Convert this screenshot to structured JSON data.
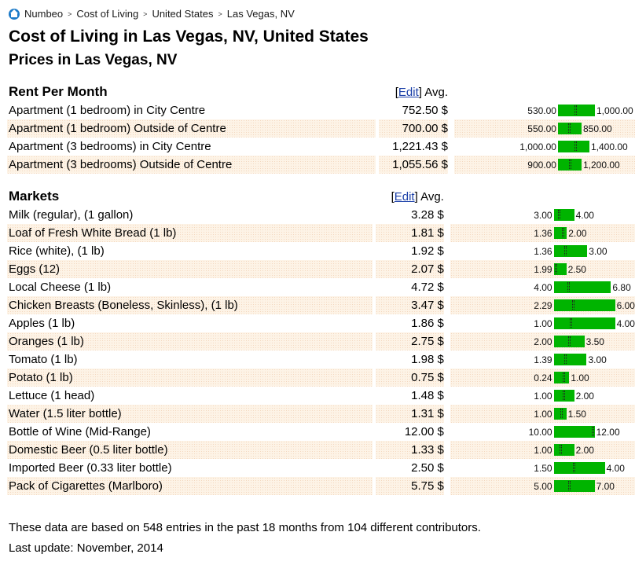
{
  "breadcrumb": {
    "home_icon": "home-icon",
    "items": [
      "Numbeo",
      "Cost of Living",
      "United States",
      "Las Vegas, NV"
    ],
    "separator": ">"
  },
  "page_title": "Cost of Living in Las Vegas, NV, United States",
  "subtitle": "Prices in Las Vegas, NV",
  "sections": [
    {
      "title": "Rent Per Month",
      "edit_label": "Edit",
      "avg_label": "Avg.",
      "rows": [
        {
          "name": "Apartment (1 bedroom) in City Centre",
          "avg": "752.50 $",
          "low": "530.00",
          "high": "1,000.00",
          "low_v": 530,
          "high_v": 1000,
          "avg_v": 752.5
        },
        {
          "name": "Apartment (1 bedroom) Outside of Centre",
          "avg": "700.00 $",
          "low": "550.00",
          "high": "850.00",
          "low_v": 550,
          "high_v": 850,
          "avg_v": 700
        },
        {
          "name": "Apartment (3 bedrooms) in City Centre",
          "avg": "1,221.43 $",
          "low": "1,000.00",
          "high": "1,400.00",
          "low_v": 1000,
          "high_v": 1400,
          "avg_v": 1221.43
        },
        {
          "name": "Apartment (3 bedrooms) Outside of Centre",
          "avg": "1,055.56 $",
          "low": "900.00",
          "high": "1,200.00",
          "low_v": 900,
          "high_v": 1200,
          "avg_v": 1055.56
        }
      ]
    },
    {
      "title": "Markets",
      "edit_label": "Edit",
      "avg_label": "Avg.",
      "rows": [
        {
          "name": "Milk (regular), (1 gallon)",
          "avg": "3.28 $",
          "low": "3.00",
          "high": "4.00",
          "low_v": 3.0,
          "high_v": 4.0,
          "avg_v": 3.28
        },
        {
          "name": "Loaf of Fresh White Bread (1 lb)",
          "avg": "1.81 $",
          "low": "1.36",
          "high": "2.00",
          "low_v": 1.36,
          "high_v": 2.0,
          "avg_v": 1.81
        },
        {
          "name": "Rice (white), (1 lb)",
          "avg": "1.92 $",
          "low": "1.36",
          "high": "3.00",
          "low_v": 1.36,
          "high_v": 3.0,
          "avg_v": 1.92
        },
        {
          "name": "Eggs (12)",
          "avg": "2.07 $",
          "low": "1.99",
          "high": "2.50",
          "low_v": 1.99,
          "high_v": 2.5,
          "avg_v": 2.07
        },
        {
          "name": "Local Cheese (1 lb)",
          "avg": "4.72 $",
          "low": "4.00",
          "high": "6.80",
          "low_v": 4.0,
          "high_v": 6.8,
          "avg_v": 4.72
        },
        {
          "name": "Chicken Breasts (Boneless, Skinless), (1 lb)",
          "avg": "3.47 $",
          "low": "2.29",
          "high": "6.00",
          "low_v": 2.29,
          "high_v": 6.0,
          "avg_v": 3.47
        },
        {
          "name": "Apples (1 lb)",
          "avg": "1.86 $",
          "low": "1.00",
          "high": "4.00",
          "low_v": 1.0,
          "high_v": 4.0,
          "avg_v": 1.86
        },
        {
          "name": "Oranges (1 lb)",
          "avg": "2.75 $",
          "low": "2.00",
          "high": "3.50",
          "low_v": 2.0,
          "high_v": 3.5,
          "avg_v": 2.75
        },
        {
          "name": "Tomato (1 lb)",
          "avg": "1.98 $",
          "low": "1.39",
          "high": "3.00",
          "low_v": 1.39,
          "high_v": 3.0,
          "avg_v": 1.98
        },
        {
          "name": "Potato (1 lb)",
          "avg": "0.75 $",
          "low": "0.24",
          "high": "1.00",
          "low_v": 0.24,
          "high_v": 1.0,
          "avg_v": 0.75
        },
        {
          "name": "Lettuce (1 head)",
          "avg": "1.48 $",
          "low": "1.00",
          "high": "2.00",
          "low_v": 1.0,
          "high_v": 2.0,
          "avg_v": 1.48
        },
        {
          "name": "Water (1.5 liter bottle)",
          "avg": "1.31 $",
          "low": "1.00",
          "high": "1.50",
          "low_v": 1.0,
          "high_v": 1.5,
          "avg_v": 1.31
        },
        {
          "name": "Bottle of Wine (Mid-Range)",
          "avg": "12.00 $",
          "low": "10.00",
          "high": "12.00",
          "low_v": 10.0,
          "high_v": 12.0,
          "avg_v": 12.0
        },
        {
          "name": "Domestic Beer (0.5 liter bottle)",
          "avg": "1.33 $",
          "low": "1.00",
          "high": "2.00",
          "low_v": 1.0,
          "high_v": 2.0,
          "avg_v": 1.33
        },
        {
          "name": "Imported Beer (0.33 liter bottle)",
          "avg": "2.50 $",
          "low": "1.50",
          "high": "4.00",
          "low_v": 1.5,
          "high_v": 4.0,
          "avg_v": 2.5
        },
        {
          "name": "Pack of Cigarettes (Marlboro)",
          "avg": "5.75 $",
          "low": "5.00",
          "high": "7.00",
          "low_v": 5.0,
          "high_v": 7.0,
          "avg_v": 5.75
        }
      ]
    }
  ],
  "footer": {
    "note": "These data are based on 548 entries in the past 18 months from 104 different contributors.",
    "last_update": "Last update: November, 2014"
  },
  "colors": {
    "range_bar": "#00b400",
    "link": "#1a3fa8",
    "home_icon": "#1c7ac8",
    "alt_row": "#fdf3e6"
  }
}
